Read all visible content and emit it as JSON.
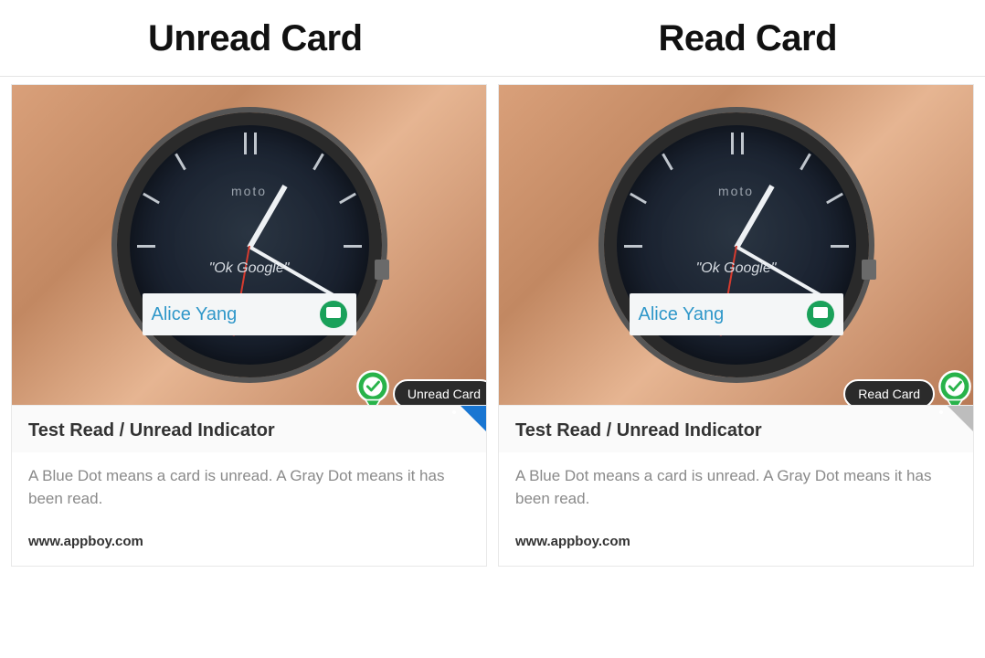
{
  "headers": {
    "unread": "Unread Card",
    "read": "Read Card"
  },
  "watch": {
    "brand": "moto",
    "voice_prompt": "\"Ok Google\"",
    "notification_name": "Alice Yang"
  },
  "badges": {
    "unread_pill": "Unread Card",
    "read_pill": "Read Card"
  },
  "card": {
    "title": "Test Read / Unread Indicator",
    "description": "A Blue Dot means a card is unread. A Gray Dot means it has been read.",
    "footer_link": "www.appboy.com"
  }
}
